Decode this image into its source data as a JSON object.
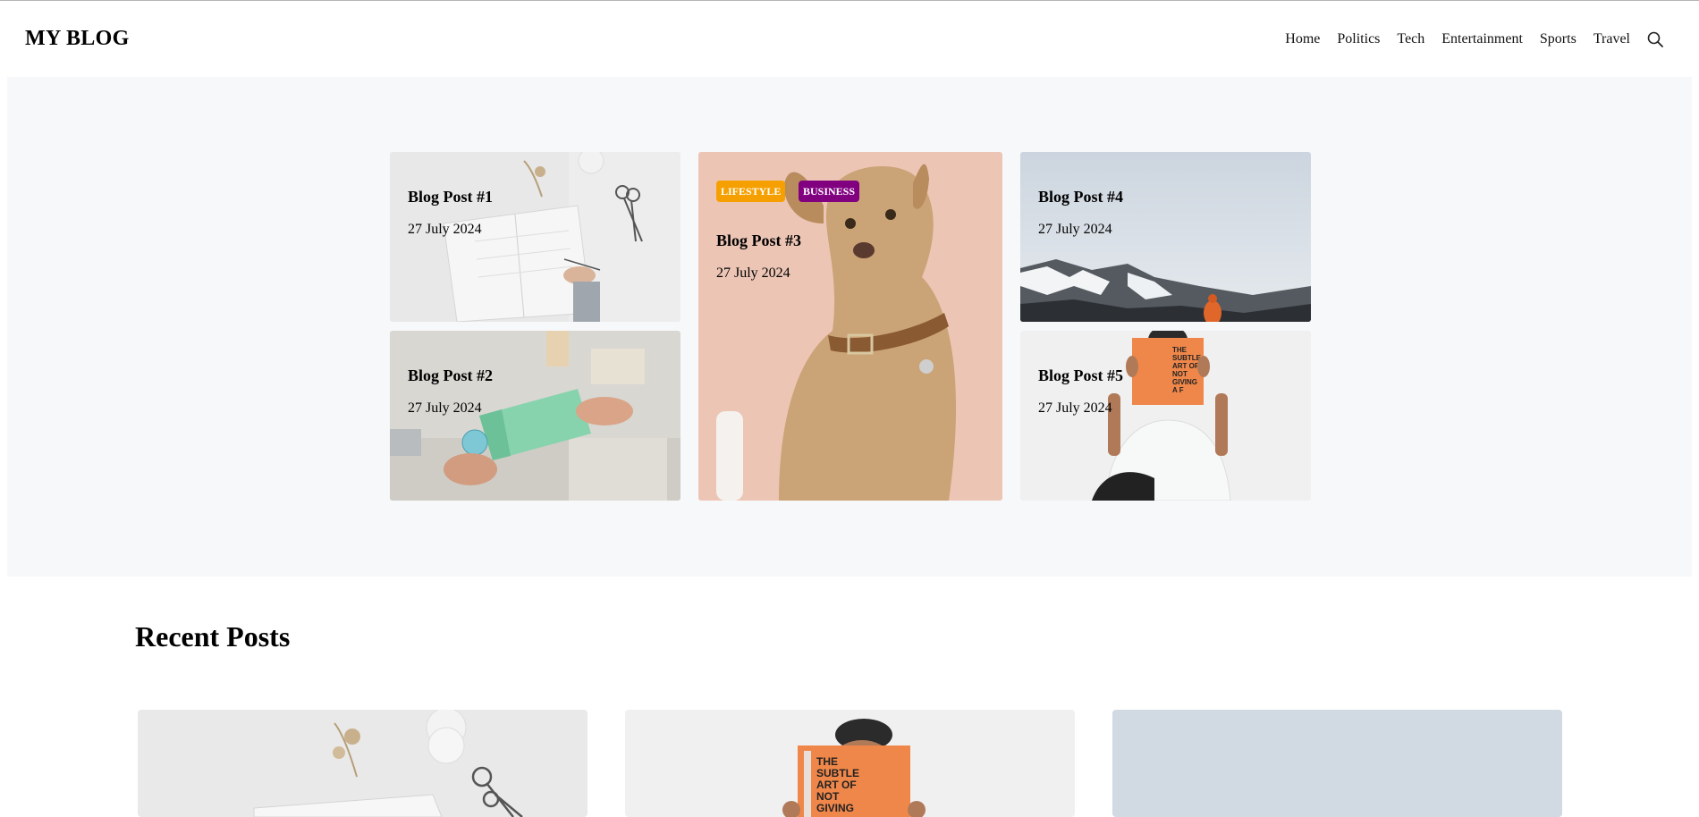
{
  "site": {
    "logo": "MY BLOG"
  },
  "nav": {
    "items": [
      "Home",
      "Politics",
      "Tech",
      "Entertainment",
      "Sports",
      "Travel"
    ],
    "search_icon": "search-icon"
  },
  "featured": [
    {
      "title": "Blog Post #1",
      "date": "27 July 2024",
      "image": "notebook-desk-photo"
    },
    {
      "title": "Blog Post #2",
      "date": "27 July 2024",
      "image": "hands-box-photo"
    },
    {
      "title": "Blog Post #3",
      "date": "27 July 2024",
      "image": "dog-photo",
      "badges": [
        {
          "label": "LIFESTYLE",
          "color": "#f5a000"
        },
        {
          "label": "BUSINESS",
          "color": "#800080"
        }
      ]
    },
    {
      "title": "Blog Post #4",
      "date": "27 July 2024",
      "image": "mountain-fog-photo"
    },
    {
      "title": "Blog Post #5",
      "date": "27 July 2024",
      "image": "man-reading-book-photo"
    }
  ],
  "recent": {
    "heading": "Recent Posts",
    "cards": [
      {
        "image": "notebook-desk-photo"
      },
      {
        "image": "man-reading-book-photo",
        "book_text": "THE SUBTLE ART OF NOT GIVING A F"
      },
      {
        "image": "mountain-fog-photo"
      }
    ]
  },
  "colors": {
    "hero_bg": "#f7f8fa",
    "book_orange": "#f0874a"
  }
}
